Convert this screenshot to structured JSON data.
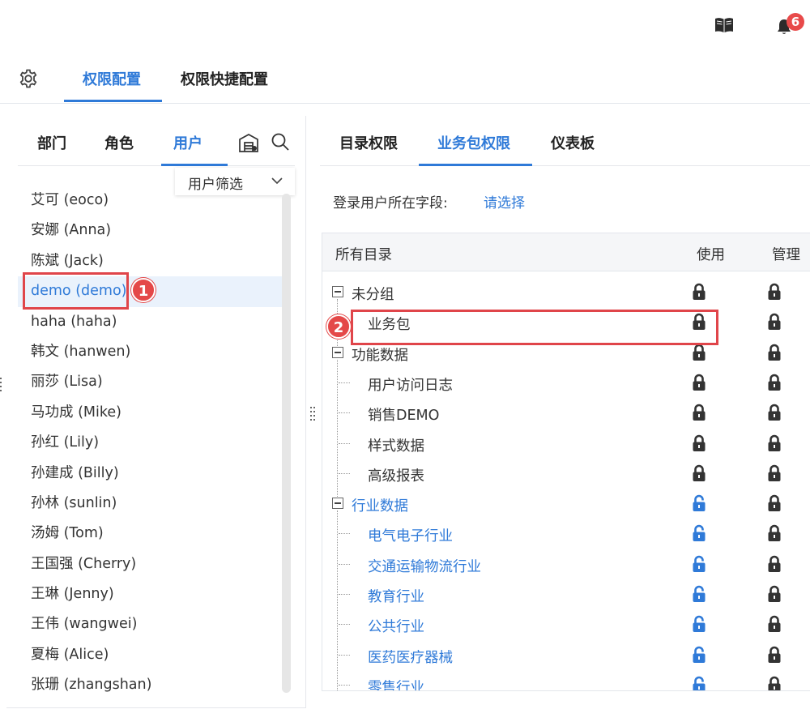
{
  "topbar": {
    "book_icon": "book-icon",
    "bell_icon": "bell-icon",
    "notification_count": "6"
  },
  "tabs": {
    "settings_icon": "gear-icon",
    "items": [
      {
        "label": "权限配置",
        "active": true
      },
      {
        "label": "权限快捷配置",
        "active": false
      }
    ]
  },
  "left": {
    "tabs": [
      {
        "label": "部门",
        "active": false
      },
      {
        "label": "角色",
        "active": false
      },
      {
        "label": "用户",
        "active": true
      }
    ],
    "filter_label": "用户筛选",
    "users": [
      "艾可 (eoco)",
      "安娜 (Anna)",
      "陈斌 (Jack)",
      "demo (demo)",
      "haha (haha)",
      "韩文 (hanwen)",
      "丽莎 (Lisa)",
      "马功成 (Mike)",
      "孙红 (Lily)",
      "孙建成 (Billy)",
      "孙林 (sunlin)",
      "汤姆 (Tom)",
      "王国强 (Cherry)",
      "王琳 (Jenny)",
      "王伟 (wangwei)",
      "夏梅 (Alice)",
      "张珊 (zhangshan)"
    ],
    "selected_user": "demo (demo)",
    "marker_1": "1"
  },
  "right": {
    "tabs": [
      {
        "label": "目录权限",
        "active": false
      },
      {
        "label": "业务包权限",
        "active": true
      },
      {
        "label": "仪表板",
        "active": false
      }
    ],
    "field_label": "登录用户所在字段:",
    "field_link": "请选择",
    "table_headers": {
      "name": "所有目录",
      "use": "使用",
      "manage": "管理"
    },
    "rows": [
      {
        "label": "未分组",
        "level": 0,
        "expandable": true,
        "color": "dark",
        "use": "locked",
        "manage": "locked"
      },
      {
        "label": "业务包",
        "level": 1,
        "expandable": false,
        "color": "dark",
        "use": "locked",
        "manage": "locked"
      },
      {
        "label": "功能数据",
        "level": 0,
        "expandable": true,
        "color": "dark",
        "use": "locked",
        "manage": "locked"
      },
      {
        "label": "用户访问日志",
        "level": 1,
        "expandable": false,
        "color": "dark",
        "use": "locked",
        "manage": "locked"
      },
      {
        "label": "销售DEMO",
        "level": 1,
        "expandable": false,
        "color": "dark",
        "use": "locked",
        "manage": "locked"
      },
      {
        "label": "样式数据",
        "level": 1,
        "expandable": false,
        "color": "dark",
        "use": "locked",
        "manage": "locked"
      },
      {
        "label": "高级报表",
        "level": 1,
        "expandable": false,
        "color": "dark",
        "use": "locked",
        "manage": "locked"
      },
      {
        "label": "行业数据",
        "level": 0,
        "expandable": true,
        "color": "blue",
        "use": "unlocked",
        "manage": "locked"
      },
      {
        "label": "电气电子行业",
        "level": 1,
        "expandable": false,
        "color": "blue",
        "use": "unlocked",
        "manage": "locked"
      },
      {
        "label": "交通运输物流行业",
        "level": 1,
        "expandable": false,
        "color": "blue",
        "use": "unlocked",
        "manage": "locked"
      },
      {
        "label": "教育行业",
        "level": 1,
        "expandable": false,
        "color": "blue",
        "use": "unlocked",
        "manage": "locked"
      },
      {
        "label": "公共行业",
        "level": 1,
        "expandable": false,
        "color": "blue",
        "use": "unlocked",
        "manage": "locked"
      },
      {
        "label": "医药医疗器械",
        "level": 1,
        "expandable": false,
        "color": "blue",
        "use": "unlocked",
        "manage": "locked"
      },
      {
        "label": "零售行业",
        "level": 1,
        "expandable": false,
        "color": "blue",
        "use": "unlocked",
        "manage": "locked"
      }
    ],
    "marker_2": "2"
  },
  "colors": {
    "accent": "#2f7ad8",
    "highlight_red": "#e0454a",
    "locked_icon": "#333333",
    "unlocked_icon": "#2f7ad8"
  }
}
